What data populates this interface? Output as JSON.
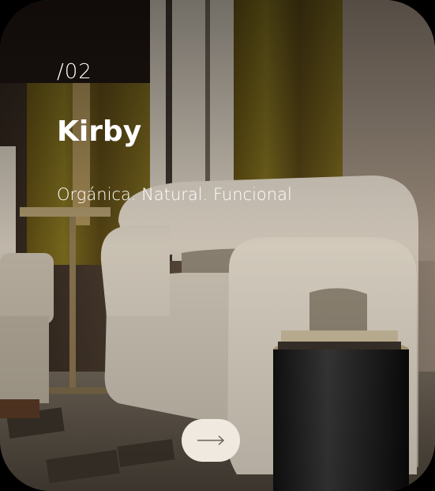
{
  "slide": {
    "number": "/02",
    "title": "Kirby",
    "subtitle": "Orgánica. Natural. Funcional"
  },
  "icons": {
    "next": "arrow-right-icon"
  },
  "colors": {
    "button_bg": "#efe9df",
    "text": "#ffffff",
    "curtain": "#6b5a1a",
    "chair": "#d9d0c2"
  }
}
